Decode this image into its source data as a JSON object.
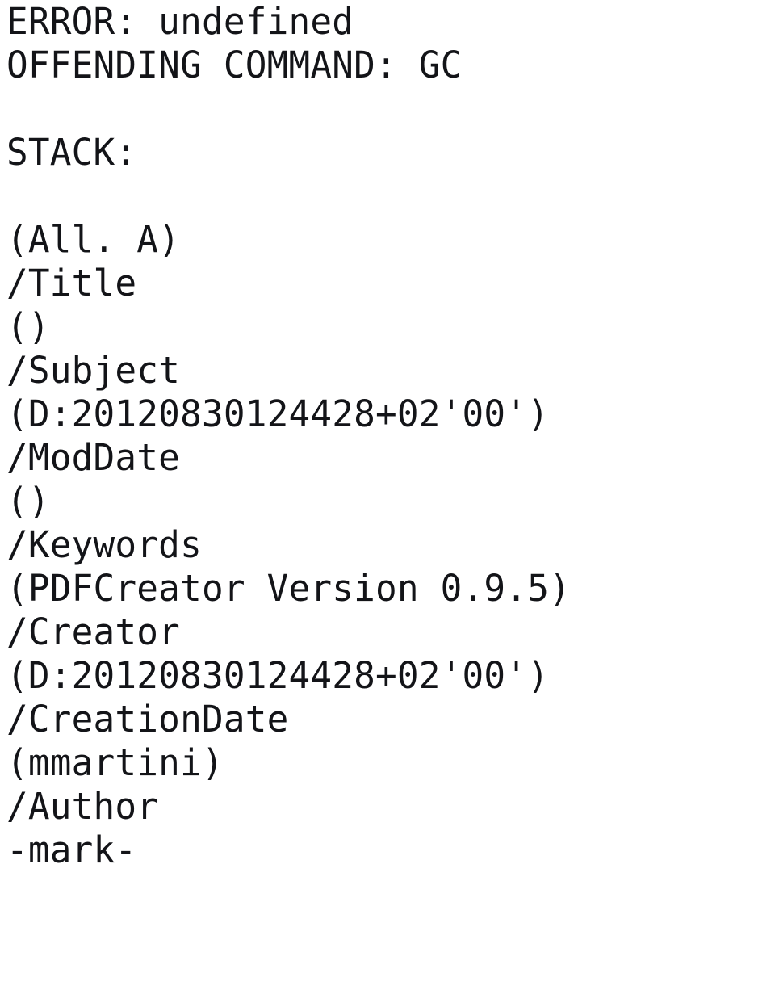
{
  "page": {
    "kind": "postscript-error-page",
    "background_color": "#ffffff",
    "text_color": "#15161a"
  },
  "error": {
    "error_line": "ERROR: undefined",
    "offending_command_line": "OFFENDING COMMAND: GC",
    "error_label": "ERROR:",
    "error_value": "undefined",
    "offending_command_label": "OFFENDING COMMAND:",
    "offending_command_value": "GC"
  },
  "stack": {
    "heading": "STACK:",
    "lines": [
      "(All. A)",
      "/Title",
      "()",
      "/Subject",
      "(D:20120830124428+02'00')",
      "/ModDate",
      "()",
      "/Keywords",
      "(PDFCreator Version 0.9.5)",
      "/Creator",
      "(D:20120830124428+02'00')",
      "/CreationDate",
      "(mmartini)",
      "/Author",
      "-mark-"
    ]
  },
  "blank": ""
}
